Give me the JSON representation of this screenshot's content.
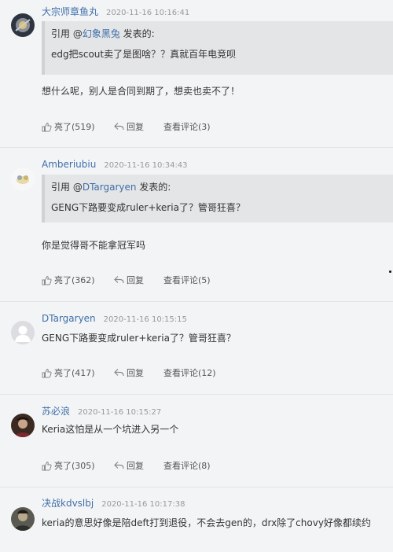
{
  "labels": {
    "quote_prefix": "引用 @",
    "quote_suffix": " 发表的:",
    "like": "亮了",
    "reply": "回复",
    "view": "查看评论"
  },
  "comments": [
    {
      "username": "大宗师章鱼丸",
      "time": "2020-11-16 10:16:41",
      "quote_user": "幻象黑兔",
      "quote_text": "edg把scout卖了是图啥？？真就百年电竞呗",
      "text": "想什么呢，别人是合同到期了，想卖也卖不了！",
      "like_count": "(519)",
      "view_count": "(3)"
    },
    {
      "username": "Amberiubiu",
      "time": "2020-11-16 10:34:43",
      "quote_user": "DTargaryen",
      "quote_text": "GENG下路要变成ruler+keria了？管哥狂喜？",
      "text": "你是觉得哥不能拿冠军吗",
      "like_count": "(362)",
      "view_count": "(5)"
    },
    {
      "username": "DTargaryen",
      "time": "2020-11-16 10:15:15",
      "text": "GENG下路要变成ruler+keria了？管哥狂喜？",
      "like_count": "(417)",
      "view_count": "(12)"
    },
    {
      "username": "苏必浪",
      "time": "2020-11-16 10:15:27",
      "text": "Keria这怕是从一个坑进入另一个",
      "like_count": "(305)",
      "view_count": "(8)"
    },
    {
      "username": "决战kdvslbj",
      "time": "2020-11-16 10:17:38",
      "text": "keria的意思好像是陪deft打到退役，不会去gen的，drx除了chovy好像都续约"
    }
  ]
}
